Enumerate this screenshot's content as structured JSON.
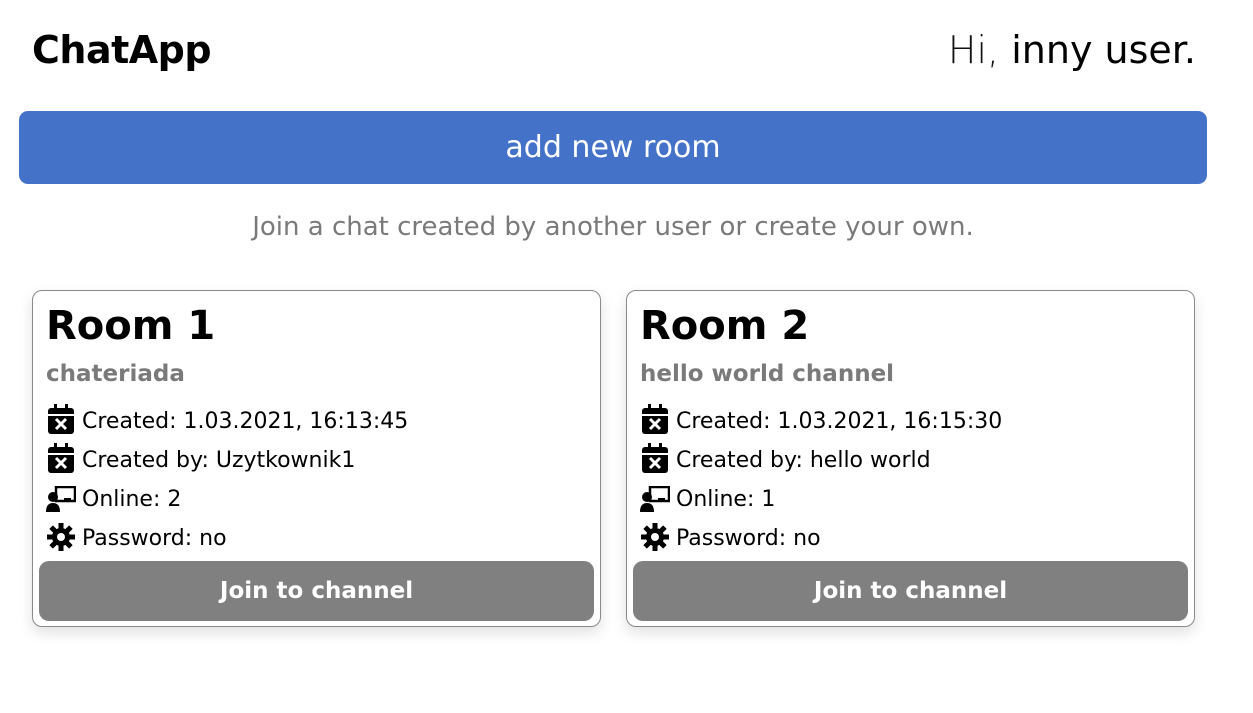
{
  "header": {
    "brand": "ChatApp",
    "greeting_prefix": "Hi,",
    "greeting_name": "inny user."
  },
  "add_room_label": "add new room",
  "hint": "Join a chat created by another user or create your own.",
  "colors": {
    "primary": "#4472c9",
    "join_button": "#808080",
    "muted_text": "#7a7a7a"
  },
  "rooms": [
    {
      "title": "Room 1",
      "description": "chateriada",
      "created": "Created: 1.03.2021, 16:13:45",
      "created_by": "Created by: Uzytkownik1",
      "online": "Online: 2",
      "password": "Password: no",
      "join_label": "Join to channel"
    },
    {
      "title": "Room 2",
      "description": "hello world channel",
      "created": "Created: 1.03.2021, 16:15:30",
      "created_by": "Created by: hello world",
      "online": "Online: 1",
      "password": "Password: no",
      "join_label": "Join to channel"
    }
  ],
  "icons": {
    "created": "calendar-x-icon",
    "created_by": "calendar-x-icon",
    "online": "user-board-icon",
    "password": "gear-icon"
  }
}
